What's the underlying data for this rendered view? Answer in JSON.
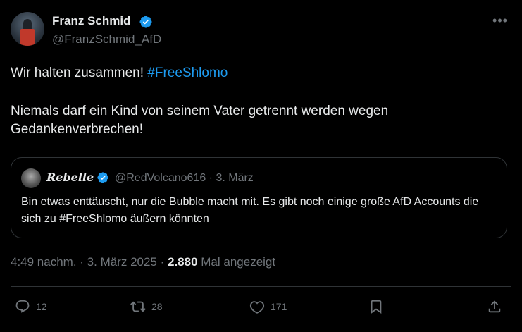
{
  "author": {
    "name": "Franz Schmid",
    "handle": "@FranzSchmid_AfD"
  },
  "tweet": {
    "line1_text": "Wir halten zusammen! ",
    "line1_hashtag": "#FreeShlomo",
    "line2": "Niemals darf ein Kind von seinem Vater getrennt werden wegen Gedankenverbrechen!"
  },
  "quote": {
    "name": "Rebelle",
    "handle_date": "@RedVolcano616 · 3. März",
    "text": "Bin etwas enttäuscht, nur die Bubble macht mit. Es gibt noch einige große AfD Accounts die sich zu #FreeShlomo äußern könnten"
  },
  "meta": {
    "time_date": "4:49 nachm. · 3. März 2025 · ",
    "views": "2.880",
    "views_label": " Mal angezeigt"
  },
  "actions": {
    "replies": "12",
    "retweets": "28",
    "likes": "171"
  },
  "colors": {
    "accent": "#1d9bf0",
    "background": "#000000",
    "muted": "#71767b",
    "text": "#e7e9ea"
  }
}
